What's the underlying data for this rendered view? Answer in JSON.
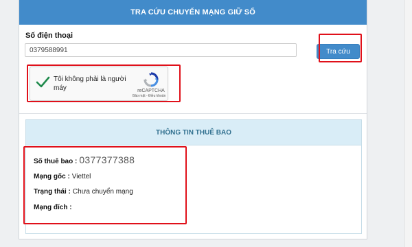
{
  "header": {
    "title": "TRA CỨU CHUYỂN MẠNG GIỮ SỐ"
  },
  "form": {
    "phone_label": "Số điện thoại",
    "phone_value": "0379588991",
    "search_label": "Tra cứu"
  },
  "recaptcha": {
    "label": "Tôi không phải là người máy",
    "brand": "reCAPTCHA",
    "terms": "Bảo mật - Điều khoản"
  },
  "subscriber": {
    "title": "THÔNG TIN THUÊ BAO",
    "number_label": "Số thuê bao :",
    "number_value": "0377377388",
    "origin_label": "Mạng gốc :",
    "origin_value": "Viettel",
    "status_label": "Trạng thái :",
    "status_value": "Chưa chuyển mạng",
    "dest_label": "Mạng đích :",
    "dest_value": ""
  },
  "colors": {
    "header_bg": "#428bca",
    "button_bg": "#428bca",
    "highlight": "#e0101a",
    "panel_head_bg": "#d9edf7",
    "check_color": "#1f8a4c"
  },
  "icons": {
    "check": "checkmark-icon",
    "recaptcha": "recaptcha-logo-icon"
  }
}
